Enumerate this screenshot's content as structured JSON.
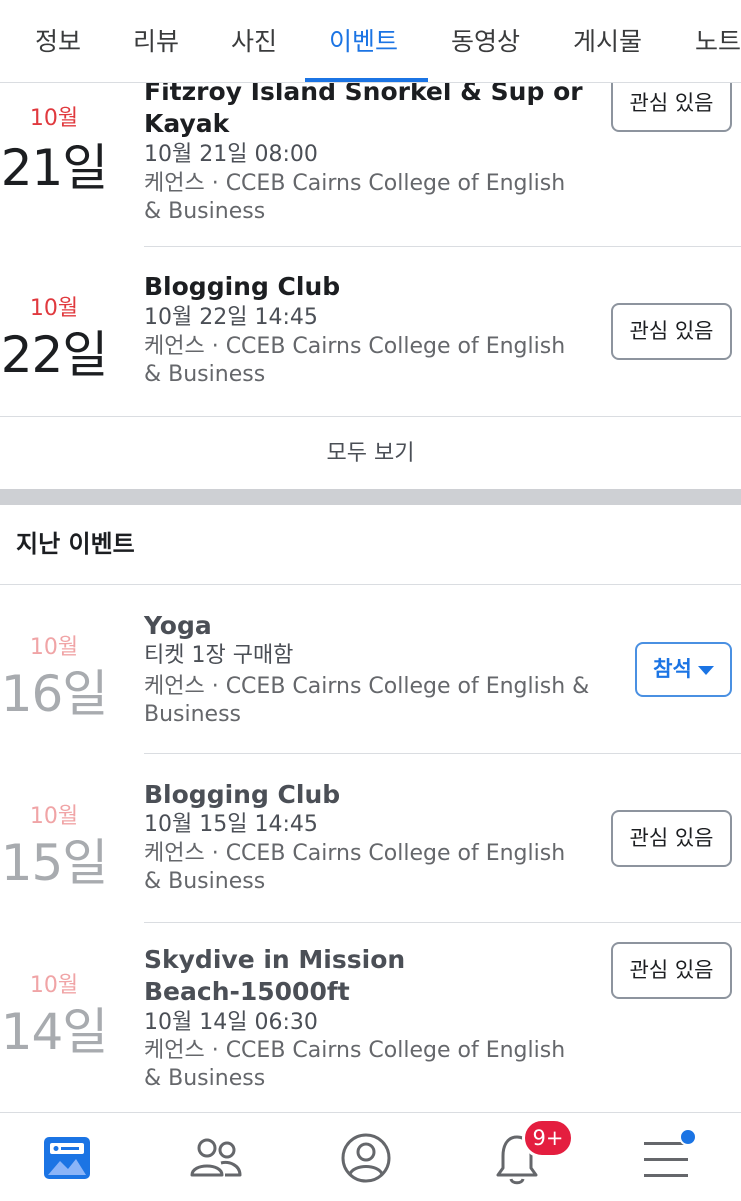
{
  "tabs": [
    {
      "label": "정보"
    },
    {
      "label": "리뷰"
    },
    {
      "label": "사진"
    },
    {
      "label": "이벤트",
      "active": true
    },
    {
      "label": "동영상"
    },
    {
      "label": "게시물"
    },
    {
      "label": "노트"
    }
  ],
  "upcoming": [
    {
      "month": "10월",
      "day": "21일",
      "title_line1": "Fitzroy Island Snorkel & Sup or",
      "title_line2": "Kayak",
      "time": "10월 21일 08:00",
      "loc_line1": "케언스 · CCEB Cairns College of English",
      "loc_line2": "& Business",
      "button": "관심 있음"
    },
    {
      "month": "10월",
      "day": "22일",
      "title_line1": "Blogging Club",
      "time": "10월 22일 14:45",
      "loc_line1": "케언스 · CCEB Cairns College of English",
      "loc_line2": "& Business",
      "button": "관심 있음"
    }
  ],
  "see_all": "모두 보기",
  "past_section_title": "지난 이벤트",
  "past": [
    {
      "month": "10월",
      "day": "16일",
      "title_line1": "Yoga",
      "time": "티켓 1장 구매함",
      "loc_line1": "케언스 · CCEB Cairns College of English &",
      "loc_line2": "Business",
      "button": "참석"
    },
    {
      "month": "10월",
      "day": "15일",
      "title_line1": "Blogging Club",
      "time": "10월 15일 14:45",
      "loc_line1": "케언스 · CCEB Cairns College of English",
      "loc_line2": "& Business",
      "button": "관심 있음"
    },
    {
      "month": "10월",
      "day": "14일",
      "title_line1": "Skydive in Mission",
      "title_line2": "Beach-15000ft",
      "time": "10월 14일 06:30",
      "loc_line1": "케언스 · CCEB Cairns College of English",
      "loc_line2": "& Business",
      "button": "관심 있음"
    }
  ],
  "bottom_nav": {
    "items": [
      {
        "icon": "news-feed-icon"
      },
      {
        "icon": "friends-icon"
      },
      {
        "icon": "profile-icon"
      },
      {
        "icon": "notifications-bell-icon"
      },
      {
        "icon": "menu-icon"
      }
    ],
    "notification_badge": "9+"
  },
  "colors": {
    "accent": "#1b74e4",
    "date_red": "#e0393e",
    "badge": "#e41e3f"
  }
}
